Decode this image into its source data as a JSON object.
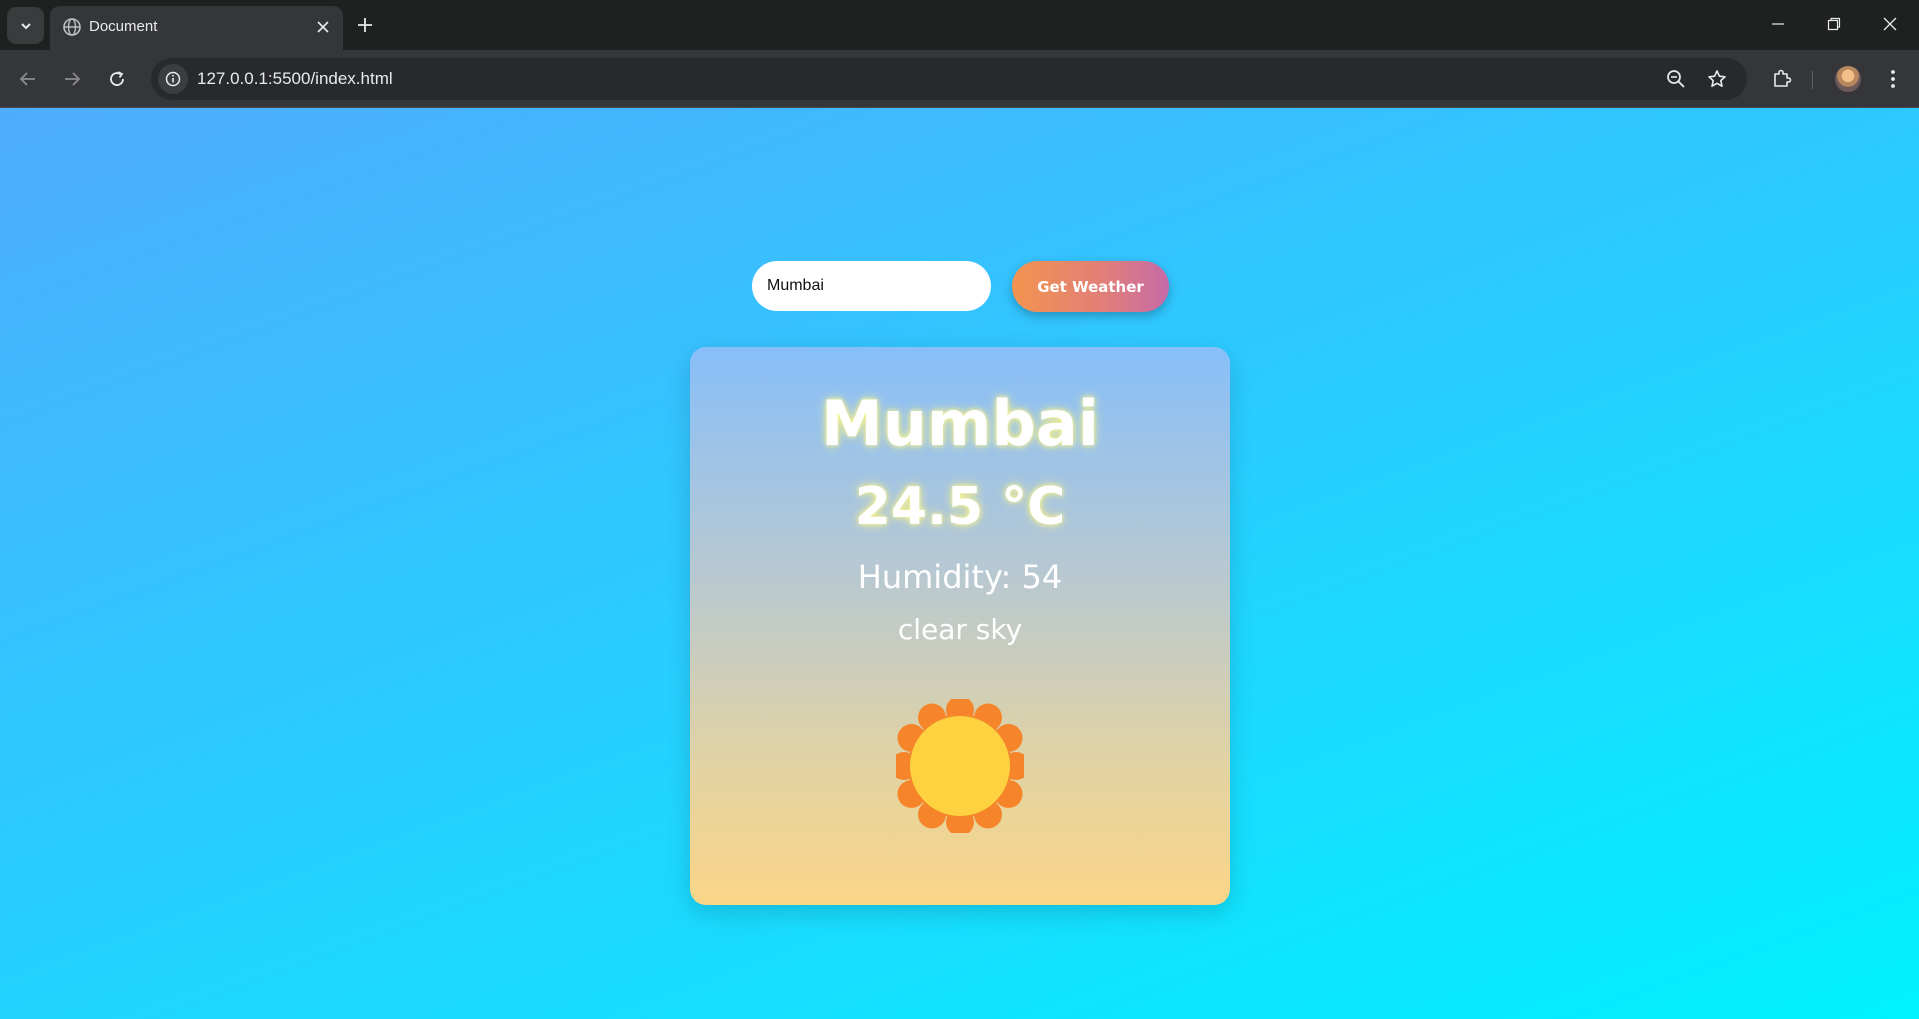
{
  "browser": {
    "tab_title": "Document",
    "url": "127.0.0.1:5500/index.html",
    "icons": [
      "tab-search-icon",
      "globe-icon",
      "close-icon",
      "plus-icon",
      "minimize-icon",
      "restore-icon",
      "window-close-icon",
      "back-icon",
      "forward-icon",
      "reload-icon",
      "site-info-icon",
      "zoom-out-icon",
      "bookmark-star-icon",
      "extensions-icon",
      "avatar",
      "more-vert-icon"
    ]
  },
  "weather_app": {
    "search": {
      "value": "Mumbai"
    },
    "button_label": "Get Weather",
    "city": "Mumbai",
    "temperature": "24.5 °C",
    "humidity": "Humidity: 54",
    "description": "clear sky",
    "icon": "sun-icon"
  },
  "colors": {
    "page_gradient": [
      "#4facfe",
      "#00f2fe"
    ],
    "button_gradient": [
      "#f3944f",
      "#c56aa8"
    ],
    "card_gradient": [
      "#87bff9",
      "#fad587"
    ],
    "sun_outer": "#f5842a",
    "sun_inner": "#fdd13f"
  }
}
